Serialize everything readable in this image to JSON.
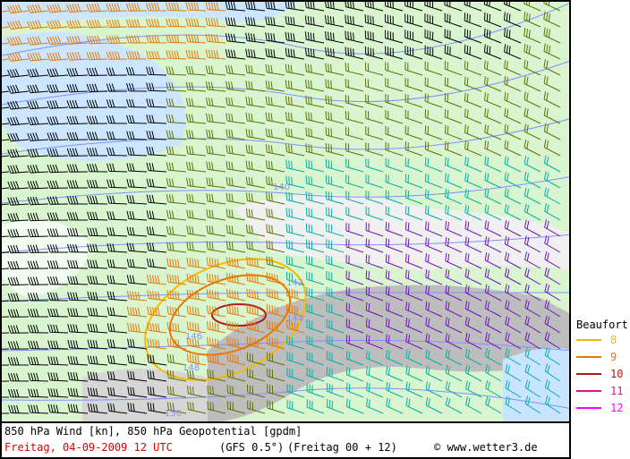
{
  "map": {
    "contour_labels": [
      "140",
      "142",
      "144",
      "146",
      "148",
      "150"
    ],
    "colors": {
      "land": "#c8f0c0",
      "sea": "#c8e4ff",
      "mountain": "#c0c0c0",
      "contour": "#8090ff",
      "border": "#555555"
    }
  },
  "legend": {
    "title": "Beaufort",
    "items": [
      {
        "label": "8",
        "color": "#f8b800"
      },
      {
        "label": "9",
        "color": "#e87800"
      },
      {
        "label": "10",
        "color": "#b01818"
      },
      {
        "label": "11",
        "color": "#e01090"
      },
      {
        "label": "12",
        "color": "#ff00ff"
      }
    ]
  },
  "footer": {
    "title": "850 hPa Wind [kn], 850 hPa Geopotential [gpdm]",
    "date": "Freitag, 04-09-2009  12 UTC",
    "model": "(GFS 0.5°)",
    "run": "(Freitag 00 + 12)",
    "copyright": "© www.wetter3.de"
  }
}
